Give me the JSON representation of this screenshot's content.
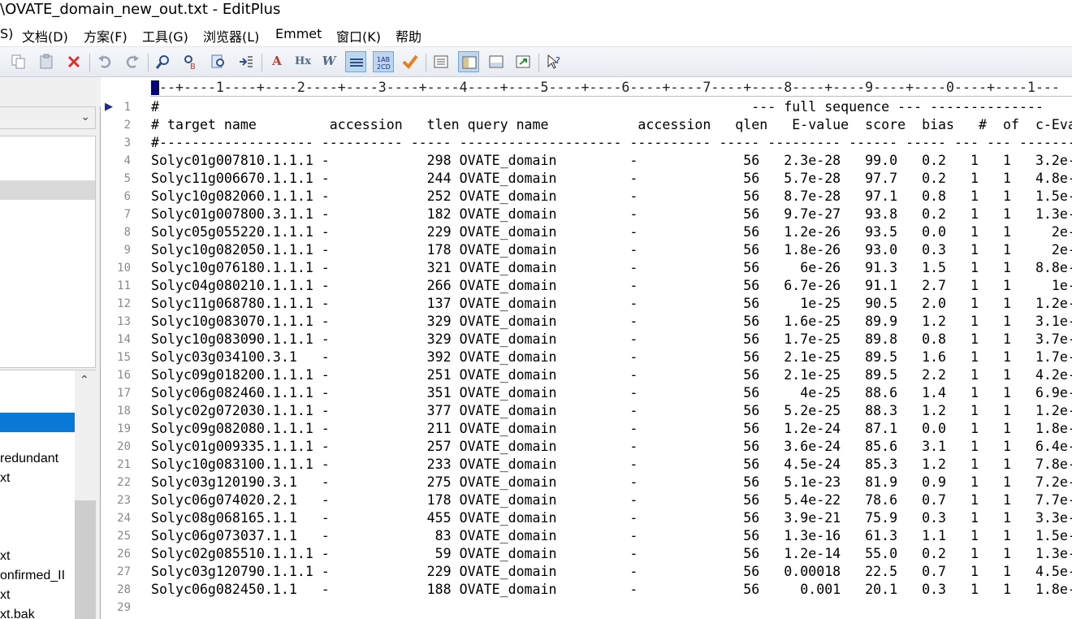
{
  "window": {
    "title": "\\OVATE_domain_new_out.txt - EditPlus"
  },
  "menu": [
    "S)",
    "文档(D)",
    "方案(F)",
    "工具(G)",
    "浏览器(L)",
    "Emmet",
    "窗口(K)",
    "帮助"
  ],
  "left_panel": {
    "file_fragments": [
      "redundant",
      "xt",
      "xt",
      "onfirmed_II",
      "xt",
      "xt.bak"
    ]
  },
  "editor": {
    "ruler": "---+----1----+----2----+----3----+----4----+----5----+----6----+----7----+----8----+----9----+----0----+----1---",
    "lines": [
      "#                                                                         --- full sequence --- --------------",
      "# target name         accession   tlen query name           accession   qlen   E-value  score  bias   #  of  c-Eval",
      "#------------------- ---------- ----- -------------------- ---------- ----- --------- ------ ----- --- --- -------",
      "Solyc01g007810.1.1.1 -            298 OVATE_domain         -             56   2.3e-28   99.0   0.2   1   1   3.2e-",
      "Solyc11g006670.1.1.1 -            244 OVATE_domain         -             56   5.7e-28   97.7   0.2   1   1   4.8e-",
      "Solyc10g082060.1.1.1 -            252 OVATE_domain         -             56   8.7e-28   97.1   0.8   1   1   1.5e-",
      "Solyc01g007800.3.1.1 -            182 OVATE_domain         -             56   9.7e-27   93.8   0.2   1   1   1.3e-",
      "Solyc05g055220.1.1.1 -            229 OVATE_domain         -             56   1.2e-26   93.5   0.0   1   1     2e-",
      "Solyc10g082050.1.1.1 -            178 OVATE_domain         -             56   1.8e-26   93.0   0.3   1   1     2e-",
      "Solyc10g076180.1.1.1 -            321 OVATE_domain         -             56     6e-26   91.3   1.5   1   1   8.8e-",
      "Solyc04g080210.1.1.1 -            266 OVATE_domain         -             56   6.7e-26   91.1   2.7   1   1     1e-",
      "Solyc11g068780.1.1.1 -            137 OVATE_domain         -             56     1e-25   90.5   2.0   1   1   1.2e-",
      "Solyc10g083070.1.1.1 -            329 OVATE_domain         -             56   1.6e-25   89.9   1.2   1   1   3.1e-",
      "Solyc10g083090.1.1.1 -            329 OVATE_domain         -             56   1.7e-25   89.8   0.8   1   1   3.7e-",
      "Solyc03g034100.3.1   -            392 OVATE_domain         -             56   2.1e-25   89.5   1.6   1   1   1.7e-",
      "Solyc09g018200.1.1.1 -            251 OVATE_domain         -             56   2.1e-25   89.5   2.2   1   1   4.2e-",
      "Solyc06g082460.1.1.1 -            351 OVATE_domain         -             56     4e-25   88.6   1.4   1   1   6.9e-",
      "Solyc02g072030.1.1.1 -            377 OVATE_domain         -             56   5.2e-25   88.3   1.2   1   1   1.2e-",
      "Solyc09g082080.1.1.1 -            211 OVATE_domain         -             56   1.2e-24   87.1   0.0   1   1   1.8e-",
      "Solyc01g009335.1.1.1 -            257 OVATE_domain         -             56   3.6e-24   85.6   3.1   1   1   6.4e-",
      "Solyc10g083100.1.1.1 -            233 OVATE_domain         -             56   4.5e-24   85.3   1.2   1   1   7.8e-",
      "Solyc03g120190.3.1   -            275 OVATE_domain         -             56   5.1e-23   81.9   0.9   1   1   7.2e-",
      "Solyc06g074020.2.1   -            178 OVATE_domain         -             56   5.4e-22   78.6   0.7   1   1   7.7e-",
      "Solyc08g068165.1.1   -            455 OVATE_domain         -             56   3.9e-21   75.9   0.3   1   1   3.3e-",
      "Solyc06g073037.1.1   -             83 OVATE_domain         -             56   1.3e-16   61.3   1.1   1   1   1.5e-",
      "Solyc02g085510.1.1.1 -             59 OVATE_domain         -             56   1.2e-14   55.0   0.2   1   1   1.3e-",
      "Solyc03g120790.1.1.1 -            229 OVATE_domain         -             56   0.00018   22.5   0.7   1   1   4.5e-",
      "Solyc06g082450.1.1   -            188 OVATE_domain         -             56     0.001   20.1   0.3   1   1   1.8e-",
      ""
    ]
  }
}
